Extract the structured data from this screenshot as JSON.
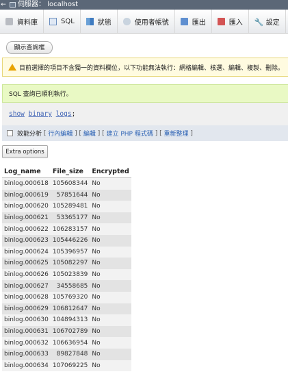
{
  "titlebar": {
    "back_glyph": "←",
    "server_label": "伺服器： localhost"
  },
  "tabs": [
    {
      "label": "資料庫",
      "icon": "database-icon"
    },
    {
      "label": "SQL",
      "icon": "sql-icon"
    },
    {
      "label": "狀態",
      "icon": "status-icon"
    },
    {
      "label": "使用者帳號",
      "icon": "users-icon"
    },
    {
      "label": "匯出",
      "icon": "export-icon"
    },
    {
      "label": "匯入",
      "icon": "import-icon"
    },
    {
      "label": "設定",
      "icon": "settings-icon"
    }
  ],
  "show_query_button": "顯示查詢框",
  "warning_text": "目前選擇的項目不含獨一的資料欄位，以下功能無法執行：網格編輯、核選、編輯、複製、刪除。",
  "success_text": "SQL 查詢已順利執行。",
  "sql": {
    "kw1": "show",
    "kw2": "binary",
    "kw3": "logs",
    "semicolon": ";"
  },
  "profile_bar": {
    "profiling": "效能分析",
    "inline_edit": "行內編輯",
    "edit": "編輯",
    "create_php": "建立 PHP 程式碼",
    "refresh": "重新整理"
  },
  "extra_options_button": "Extra options",
  "table": {
    "headers": [
      "Log_name",
      "File_size",
      "Encrypted"
    ],
    "rows": [
      [
        "binlog.000618",
        "105608344",
        "No"
      ],
      [
        "binlog.000619",
        "57851644",
        "No"
      ],
      [
        "binlog.000620",
        "105289481",
        "No"
      ],
      [
        "binlog.000621",
        "53365177",
        "No"
      ],
      [
        "binlog.000622",
        "106283157",
        "No"
      ],
      [
        "binlog.000623",
        "105446226",
        "No"
      ],
      [
        "binlog.000624",
        "105396957",
        "No"
      ],
      [
        "binlog.000625",
        "105082297",
        "No"
      ],
      [
        "binlog.000626",
        "105023839",
        "No"
      ],
      [
        "binlog.000627",
        "34558685",
        "No"
      ],
      [
        "binlog.000628",
        "105769320",
        "No"
      ],
      [
        "binlog.000629",
        "106812647",
        "No"
      ],
      [
        "binlog.000630",
        "104894313",
        "No"
      ],
      [
        "binlog.000631",
        "106702789",
        "No"
      ],
      [
        "binlog.000632",
        "106636954",
        "No"
      ],
      [
        "binlog.000633",
        "89827848",
        "No"
      ],
      [
        "binlog.000634",
        "107069225",
        "No"
      ]
    ]
  }
}
